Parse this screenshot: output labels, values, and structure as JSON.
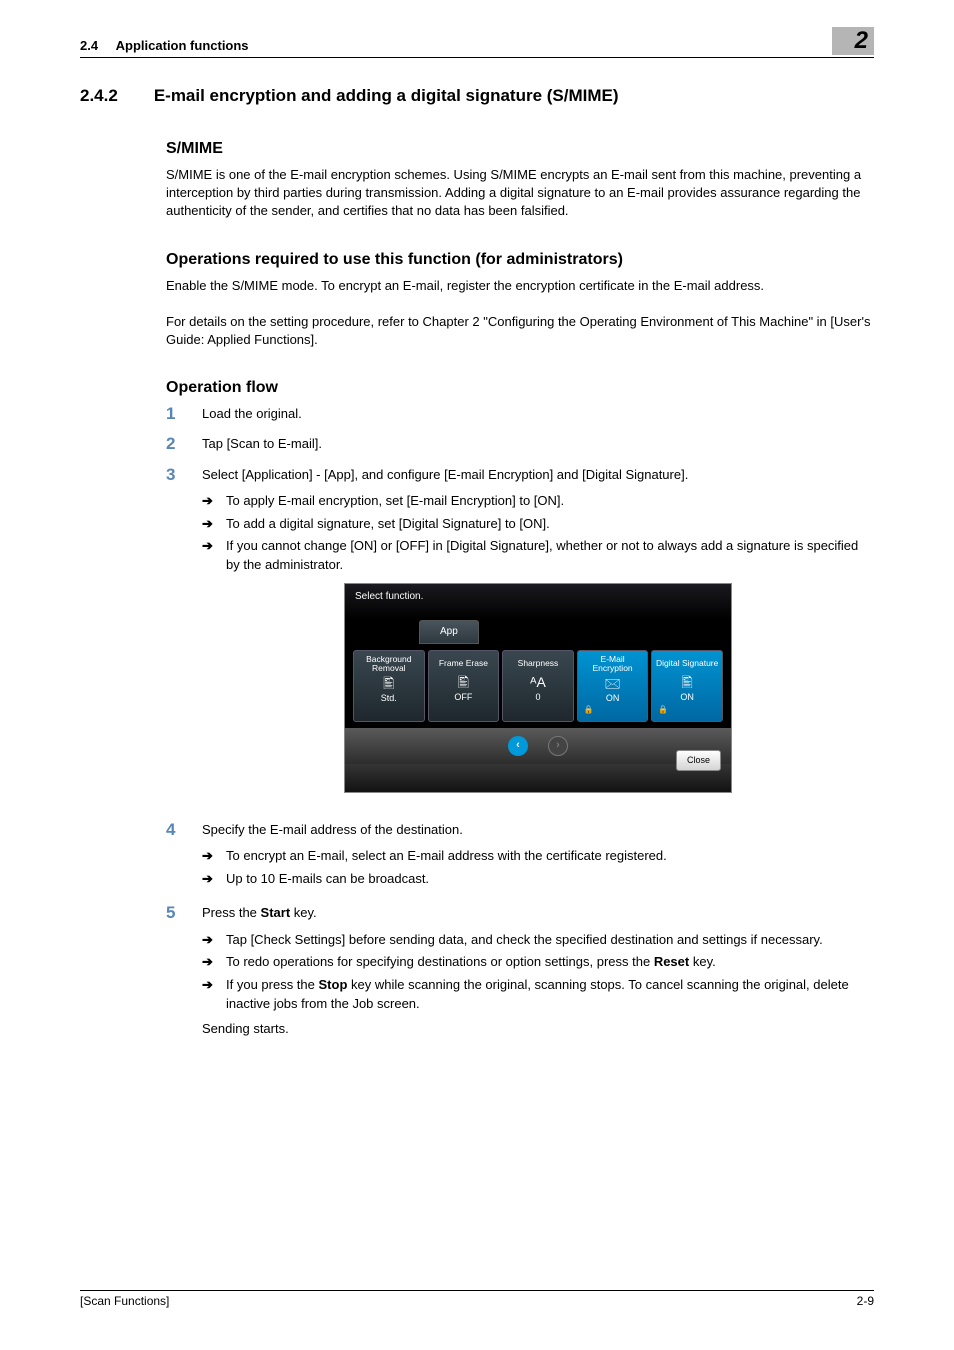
{
  "header": {
    "section_no": "2.4",
    "section_name": "Application functions",
    "chapter_badge": "2"
  },
  "title": {
    "number": "2.4.2",
    "text": "E-mail encryption and adding a digital signature (S/MIME)"
  },
  "smime": {
    "heading": "S/MIME",
    "para": "S/MIME is one of the E-mail encryption schemes. Using S/MIME encrypts an E-mail sent from this machine, preventing a interception by third parties during transmission. Adding a digital signature to an E-mail provides assurance regarding the authenticity of the sender, and certifies that no data has been falsified."
  },
  "ops_req": {
    "heading": "Operations required to use this function (for administrators)",
    "p1": "Enable the S/MIME mode. To encrypt an E-mail, register the encryption certificate in the E-mail address.",
    "p2": "For details on the setting procedure, refer to Chapter 2 \"Configuring the Operating Environment of This Machine\" in [User's Guide: Applied Functions]."
  },
  "opflow": {
    "heading": "Operation flow",
    "steps": {
      "s1": "Load the original.",
      "s2": "Tap [Scan to E-mail].",
      "s3": "Select [Application] - [App], and configure [E-mail Encryption] and [Digital Signature].",
      "s3_subs": [
        "To apply E-mail encryption, set [E-mail Encryption] to [ON].",
        "To add a digital signature, set [Digital Signature] to [ON].",
        "If you cannot change [ON] or [OFF] in [Digital Signature], whether or not to always add a signature is specified by the administrator."
      ],
      "s4": "Specify the E-mail address of the destination.",
      "s4_subs": [
        "To encrypt an E-mail, select an E-mail address with the certificate registered.",
        "Up to 10 E-mails can be broadcast."
      ],
      "s5_prefix": "Press the ",
      "s5_bold": "Start",
      "s5_suffix": " key.",
      "s5_subs_a": "Tap [Check Settings] before sending data, and check the specified destination and settings if necessary.",
      "s5_subs_b_pre": "To redo operations for specifying destinations or option settings, press the ",
      "s5_subs_b_bold": "Reset",
      "s5_subs_b_post": " key.",
      "s5_subs_c_pre": "If you press the ",
      "s5_subs_c_bold": "Stop",
      "s5_subs_c_post": " key while scanning the original, scanning stops. To cancel scanning the original, delete inactive jobs from the Job screen.",
      "s5_tail": "Sending starts."
    }
  },
  "screenshot": {
    "topbar": "Select function.",
    "tab": "App",
    "tiles": [
      {
        "title": "Background Removal",
        "icon": "🖺",
        "value": "Std."
      },
      {
        "title": "Frame Erase",
        "icon": "🖺",
        "value": "OFF"
      },
      {
        "title": "Sharpness",
        "icon": "ᴬA",
        "value": "0"
      },
      {
        "title": "E-Mail Encryption",
        "icon": "🖂",
        "value": "ON",
        "active": true,
        "lock": "🔒"
      },
      {
        "title": "Digital Signature",
        "icon": "🖺",
        "value": "ON",
        "active": true,
        "lock": "🔒"
      }
    ],
    "prev": "‹",
    "next": "›",
    "close": "Close"
  },
  "footer": {
    "left": "[Scan Functions]",
    "right": "2-9"
  }
}
